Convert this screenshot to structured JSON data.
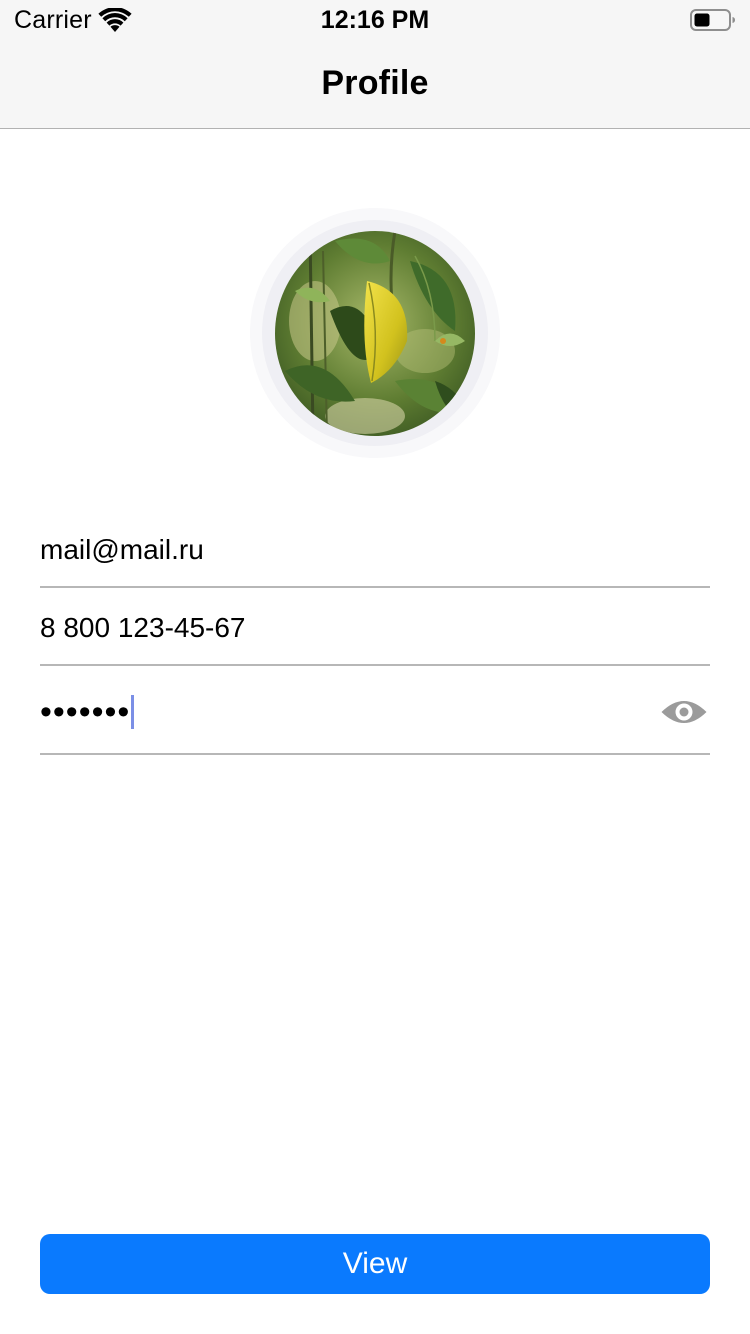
{
  "status_bar": {
    "carrier": "Carrier",
    "time": "12:16 PM",
    "wifi_icon": "wifi-icon",
    "battery_icon": "battery-icon"
  },
  "nav": {
    "title": "Profile"
  },
  "avatar": {
    "icon": "avatar-photo"
  },
  "form": {
    "email_value": "mail@mail.ru",
    "phone_value": "8 800 123-45-67",
    "password_masked": "•••••••",
    "password_toggle_icon": "eye-icon"
  },
  "actions": {
    "view_label": "View"
  },
  "colors": {
    "accent": "#0A7AFE",
    "cursor": "#7B8FE6",
    "separator": "#B7B7B7",
    "nav_background": "#F6F6F6"
  }
}
